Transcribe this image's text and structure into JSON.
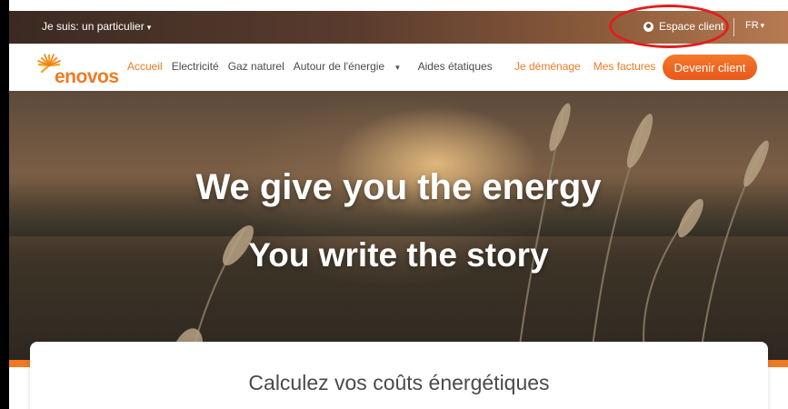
{
  "topbar": {
    "who_label": "Je suis: un particulier",
    "client_label": "Espace client",
    "language": "FR"
  },
  "logo": {
    "text": "enovos"
  },
  "nav": {
    "items": [
      "Accueil",
      "Electricité",
      "Gaz naturel",
      "Autour de l'énergie",
      "Aides étatiques"
    ],
    "right_links": [
      "Je déménage",
      "Mes factures"
    ],
    "cta_label": "Devenir client"
  },
  "hero": {
    "headline": "We give you the energy",
    "subline": "You write the story"
  },
  "calculator": {
    "title": "Calculez vos coûts énergétiques"
  },
  "colors": {
    "brand_orange": "#f07a22",
    "annotation_red": "#e31d1d"
  }
}
